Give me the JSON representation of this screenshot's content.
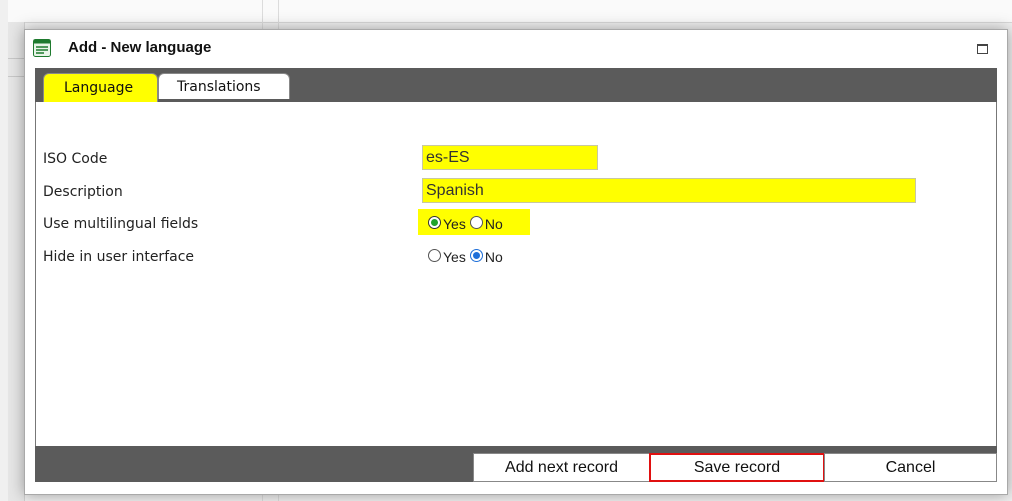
{
  "dialog": {
    "title": "Add - New language",
    "icon": "form-icon"
  },
  "tabs": [
    {
      "label": "Language",
      "active": true
    },
    {
      "label": "Translations",
      "active": false
    }
  ],
  "form": {
    "iso_code": {
      "label": "ISO Code",
      "value": "es-ES"
    },
    "description": {
      "label": "Description",
      "value": "Spanish"
    },
    "use_multilingual": {
      "label": "Use multilingual fields",
      "yes": "Yes",
      "no": "No",
      "selected": "Yes"
    },
    "hide_in_ui": {
      "label": "Hide in user interface",
      "yes": "Yes",
      "no": "No",
      "selected": "No"
    }
  },
  "buttons": {
    "add_next": "Add next record",
    "save": "Save record",
    "cancel": "Cancel"
  },
  "colors": {
    "highlight": "#ffff00",
    "bar": "#5b5b5b",
    "save_outline": "#e01010"
  }
}
